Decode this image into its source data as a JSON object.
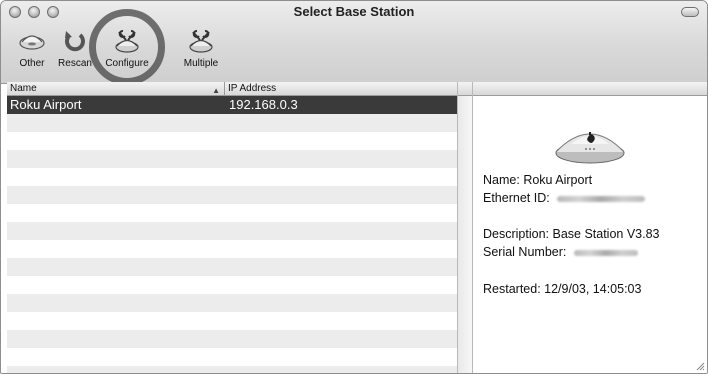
{
  "window": {
    "title": "Select Base Station"
  },
  "toolbar": {
    "items": [
      {
        "label": "Other",
        "icon": "airport-base-icon"
      },
      {
        "label": "Rescan",
        "icon": "rescan-icon"
      },
      {
        "label": "Configure",
        "icon": "configure-icon"
      },
      {
        "label": "Multiple",
        "icon": "configure-multiple-icon"
      }
    ]
  },
  "list": {
    "columns": [
      "Name",
      "IP Address"
    ],
    "rows": [
      {
        "name": "Roku Airport",
        "ip": "192.168.0.3",
        "selected": true
      }
    ]
  },
  "info": {
    "name_label": "Name:",
    "name_value": "Roku Airport",
    "ethernet_label": "Ethernet ID:",
    "description_label": "Description:",
    "description_value": "Base Station V3.83",
    "serial_label": "Serial Number:",
    "restarted_label": "Restarted:",
    "restarted_value": "12/9/03, 14:05:03"
  }
}
